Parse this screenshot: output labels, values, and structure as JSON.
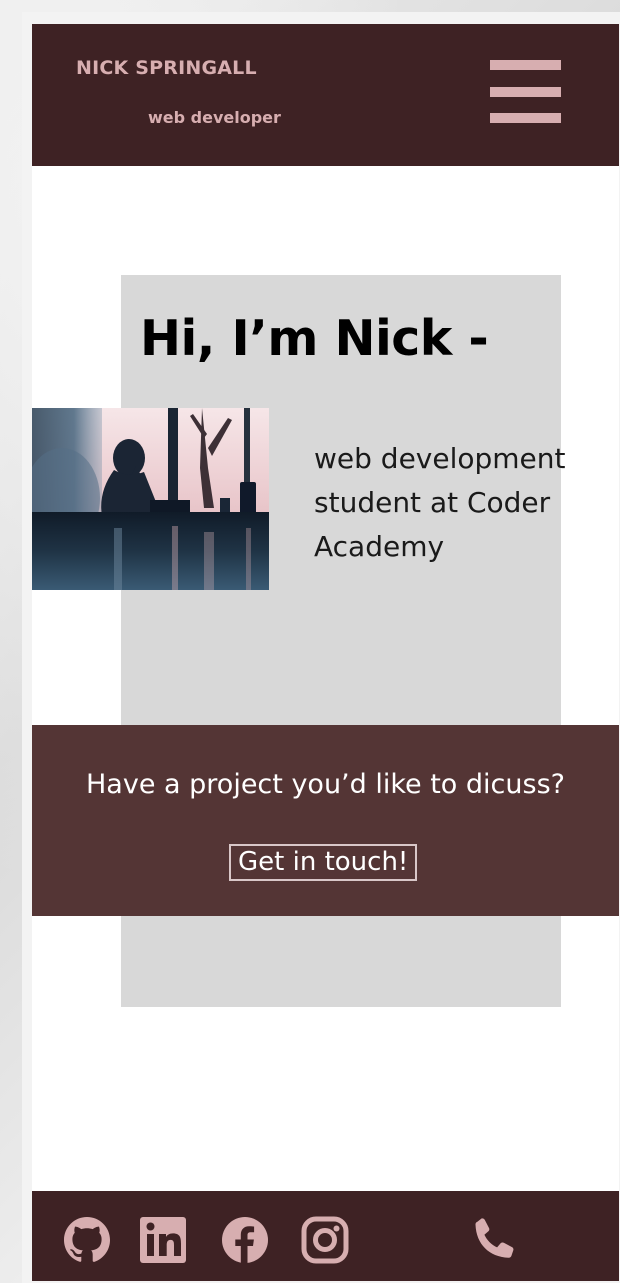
{
  "header": {
    "brand_name": "NICK SPRINGALL",
    "tagline": "web developer",
    "menu_icon": "hamburger-menu-icon"
  },
  "hero": {
    "title": "Hi, I’m Nick -",
    "bio": "web development student at Coder Academy",
    "photo": "silhouette-at-window-photo"
  },
  "cta": {
    "text": "Have a project you’d like to dicuss?",
    "button_label": "Get in touch!"
  },
  "footer": {
    "icons": [
      "github-icon",
      "linkedin-icon",
      "facebook-icon",
      "instagram-icon",
      "phone-icon"
    ]
  },
  "colors": {
    "header_bg": "#3e2224",
    "accent_pink": "#d7aeb0",
    "hero_card_bg": "#d8d8d8",
    "cta_bg": "#543535",
    "text_dark": "#000000"
  }
}
